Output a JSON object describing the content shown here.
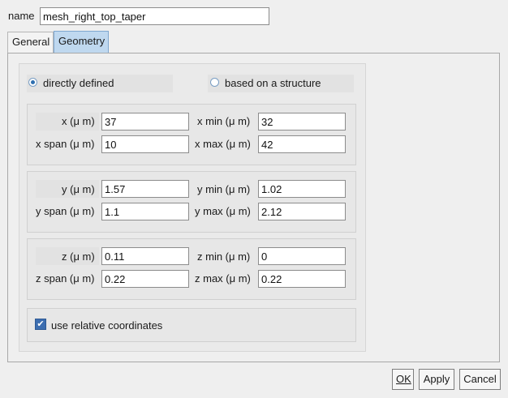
{
  "name_field": {
    "label": "name",
    "value": "mesh_right_top_taper"
  },
  "tabs": [
    {
      "label": "General",
      "active": false
    },
    {
      "label": "Geometry",
      "active": true
    }
  ],
  "definition": {
    "option_direct": "directly defined",
    "option_structure": "based on a structure",
    "selected": "directly defined"
  },
  "x": {
    "center_label": "x (μ m)",
    "center_value": "37",
    "span_label": "x span (μ m)",
    "span_value": "10",
    "min_label": "x min (μ m)",
    "min_value": "32",
    "max_label": "x max (μ m)",
    "max_value": "42"
  },
  "y": {
    "center_label": "y (μ m)",
    "center_value": "1.57",
    "span_label": "y span (μ m)",
    "span_value": "1.1",
    "min_label": "y min (μ m)",
    "min_value": "1.02",
    "max_label": "y max (μ m)",
    "max_value": "2.12"
  },
  "z": {
    "center_label": "z (μ m)",
    "center_value": "0.11",
    "span_label": "z span (μ m)",
    "span_value": "0.22",
    "min_label": "z min (μ m)",
    "min_value": "0",
    "max_label": "z max (μ m)",
    "max_value": "0.22"
  },
  "relative": {
    "label": "use relative coordinates",
    "checked": true
  },
  "buttons": {
    "ok": "OK",
    "apply": "Apply",
    "cancel": "Cancel"
  },
  "colors": {
    "accent": "#3d6eb0",
    "tab_active": "#bfd8ef"
  }
}
